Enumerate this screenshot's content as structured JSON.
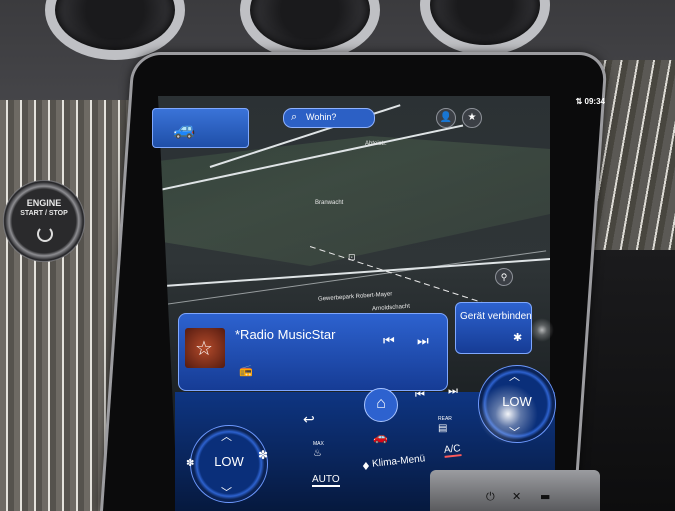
{
  "dashboard": {
    "engine_button": {
      "line1": "ENGINE",
      "line2": "START / STOP"
    }
  },
  "status_bar": {
    "time": "09:34",
    "signal_icon": "signal-icon"
  },
  "top_bar": {
    "search_placeholder": "Wohin?",
    "search_icon": "search-icon",
    "profile_icon": "profile-icon",
    "favorite_icon": "star-icon",
    "vehicle_icon": "car-icon"
  },
  "map": {
    "labels": [
      "Branwacht",
      "Abteistr.",
      "Gewerbepark Robert-Mayer",
      "Arnoldschacht"
    ]
  },
  "media": {
    "station": "*Radio MusicStar",
    "source_icon": "radio-icon",
    "prev_icon": "skip-back-icon",
    "next_icon": "skip-forward-icon"
  },
  "device_panel": {
    "label": "Gerät verbinden",
    "icon": "bluetooth-icon"
  },
  "climate": {
    "left_temp": "LOW",
    "right_temp": "LOW",
    "auto_label": "AUTO",
    "klima_label": "Klima-Menü",
    "ac_label": "A/C",
    "max_label": "MAX",
    "rear_label": "REAR",
    "home_icon": "home-icon",
    "back_icon": "back-arrow-icon"
  }
}
